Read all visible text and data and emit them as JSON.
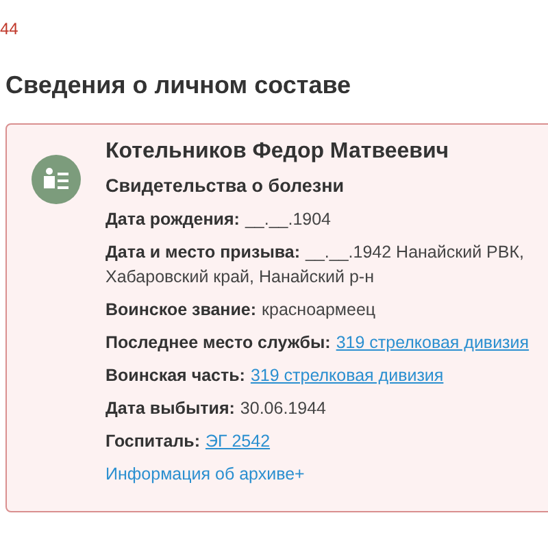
{
  "top_fragment": "44",
  "section_title": "Сведения о личном составе",
  "card": {
    "name": "Котельников Федор Матвеевич",
    "document_type": "Свидетельства о болезни",
    "fields": [
      {
        "kind": "text",
        "label": "Дата рождения:",
        "value": "__.__.1904"
      },
      {
        "kind": "text",
        "label": "Дата и место призыва:",
        "value": "__.__.1942 Нанайский РВК,",
        "value_continued": "Хабаровский край, Нанайский р-н"
      },
      {
        "kind": "text",
        "label": "Воинское звание:",
        "value": "красноармеец"
      },
      {
        "kind": "link",
        "label": "Последнее место службы:",
        "value": "319 стрелковая дивизия"
      },
      {
        "kind": "link",
        "label": "Воинская часть:",
        "value": "319 стрелковая дивизия"
      },
      {
        "kind": "text",
        "label": "Дата выбытия:",
        "value": "30.06.1944"
      },
      {
        "kind": "link",
        "label": "Госпиталь:",
        "value": "ЭГ 2542"
      }
    ],
    "archive_link": "Информация об архиве+"
  }
}
